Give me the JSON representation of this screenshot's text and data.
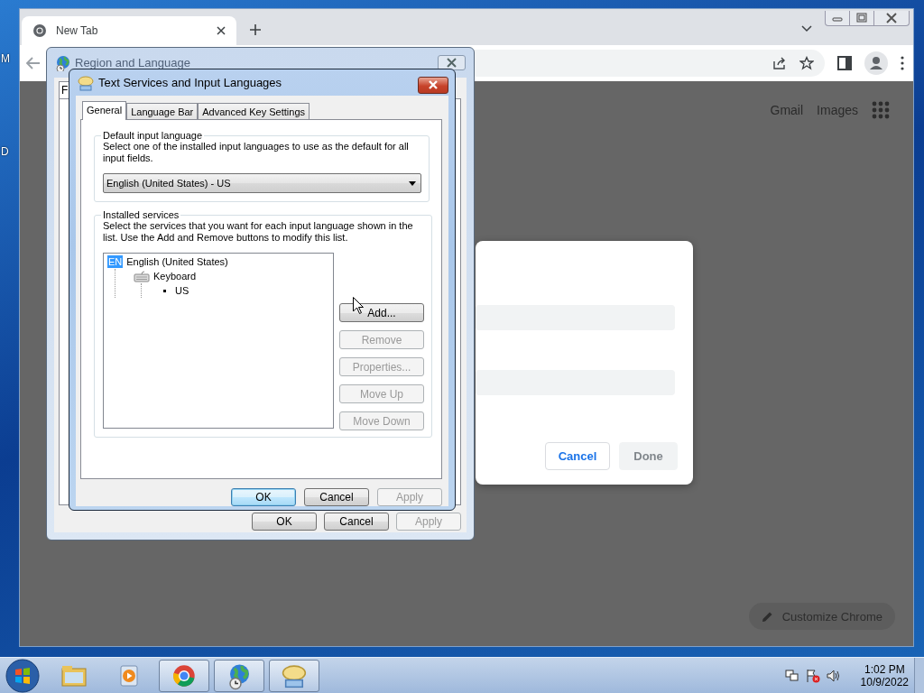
{
  "desktop": {
    "icon_labels": [
      "M",
      "D"
    ]
  },
  "browser": {
    "tabs": [
      {
        "label": "New Tab",
        "selected": true
      }
    ],
    "header_links": [
      "Gmail",
      "Images"
    ],
    "dialog": {
      "buttons": [
        {
          "label": "Cancel",
          "disabled": false
        },
        {
          "label": "Done",
          "disabled": true
        }
      ]
    },
    "customize_button": "Customize Chrome"
  },
  "region_dialog": {
    "title": "Region and Language",
    "tabs": [
      {
        "label": "F",
        "selected": true
      }
    ],
    "buttons": [
      {
        "label": "OK",
        "disabled": false
      },
      {
        "label": "Cancel",
        "disabled": false
      },
      {
        "label": "Apply",
        "disabled": true
      }
    ]
  },
  "text_services_dialog": {
    "title": "Text Services and Input Languages",
    "tabs": [
      {
        "label": "General",
        "selected": true
      },
      {
        "label": "Language Bar",
        "selected": false
      },
      {
        "label": "Advanced Key Settings",
        "selected": false
      }
    ],
    "default_language": {
      "title": "Default input language",
      "description": "Select one of the installed input languages to use as the default for all input fields.",
      "value": "English (United States) - US"
    },
    "installed_services": {
      "title": "Installed services",
      "description": "Select the services that you want for each input language shown in the list. Use the Add and Remove buttons to modify this list.",
      "tree": [
        {
          "badge": "EN",
          "label": "English (United States)",
          "children": [
            {
              "label": "Keyboard",
              "children": [
                {
                  "label": "US"
                }
              ]
            }
          ]
        }
      ],
      "buttons": [
        {
          "label": "Add...",
          "disabled": false
        },
        {
          "label": "Remove",
          "disabled": true
        },
        {
          "label": "Properties...",
          "disabled": true
        },
        {
          "label": "Move Up",
          "disabled": true
        },
        {
          "label": "Move Down",
          "disabled": true
        }
      ]
    },
    "buttons": [
      {
        "label": "OK",
        "default": true,
        "disabled": false
      },
      {
        "label": "Cancel",
        "default": false,
        "disabled": false
      },
      {
        "label": "Apply",
        "default": false,
        "disabled": true
      }
    ]
  },
  "taskbar": {
    "apps": [
      {
        "kind": "folder",
        "active": false
      },
      {
        "kind": "media",
        "active": false
      },
      {
        "kind": "chrome",
        "active": true
      },
      {
        "kind": "globe",
        "active": true
      },
      {
        "kind": "keyboard",
        "active": true
      }
    ],
    "clock": {
      "time": "1:02 PM",
      "date": "10/9/2022"
    }
  }
}
